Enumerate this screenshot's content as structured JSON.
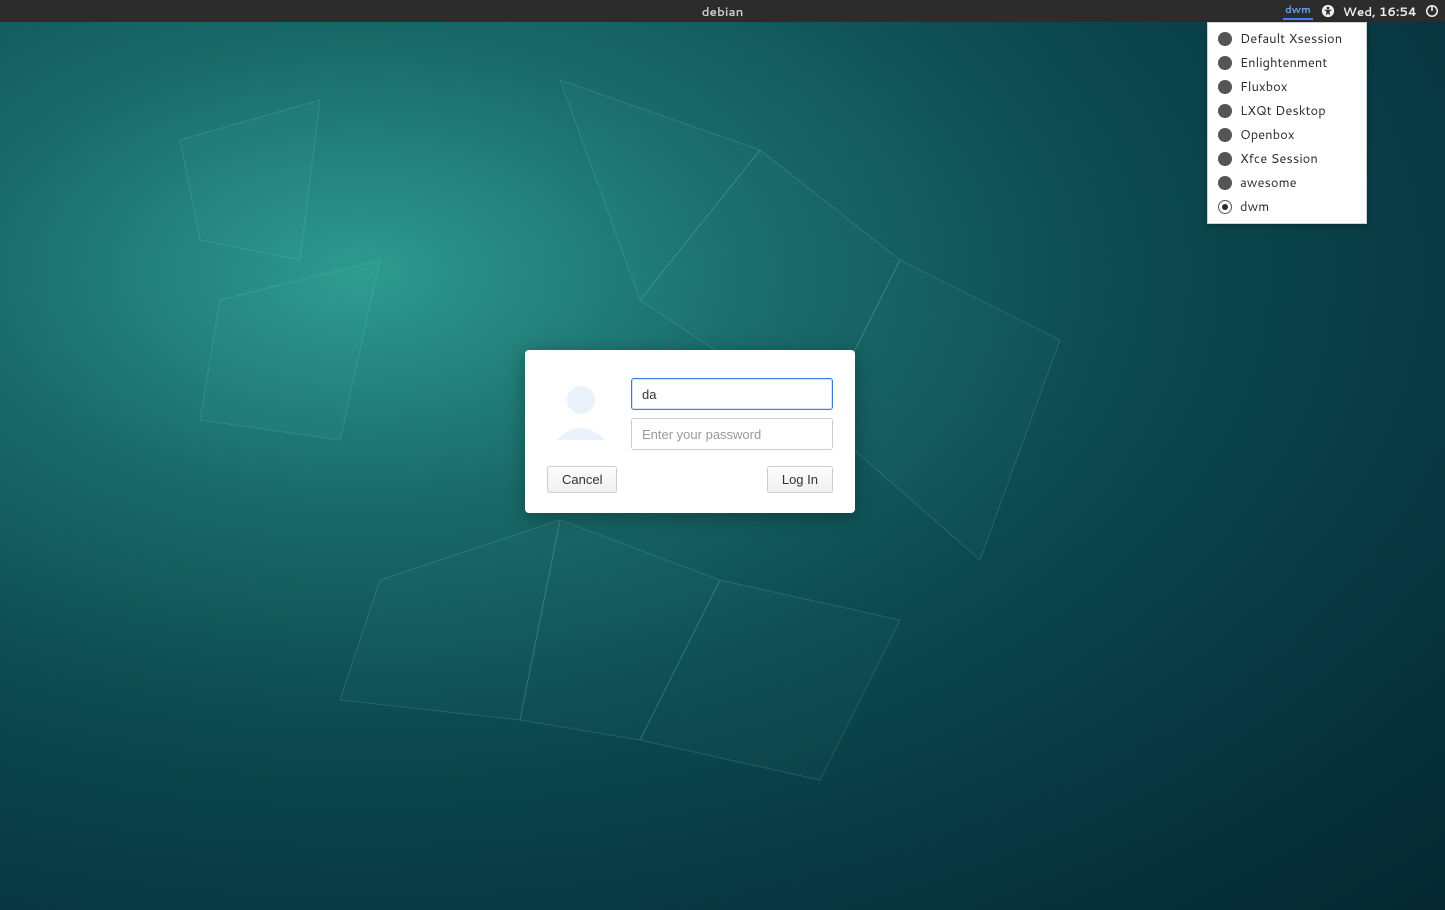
{
  "topbar": {
    "hostname": "debian",
    "session_indicator": "dwm",
    "clock": "Wed, 16:54"
  },
  "session_menu": {
    "items": [
      {
        "label": "Default Xsession",
        "selected": false
      },
      {
        "label": "Enlightenment",
        "selected": false
      },
      {
        "label": "Fluxbox",
        "selected": false
      },
      {
        "label": "LXQt Desktop",
        "selected": false
      },
      {
        "label": "Openbox",
        "selected": false
      },
      {
        "label": "Xfce Session",
        "selected": false
      },
      {
        "label": "awesome",
        "selected": false
      },
      {
        "label": "dwm",
        "selected": true
      }
    ]
  },
  "login": {
    "username_value": "da",
    "password_value": "",
    "password_placeholder": "Enter your password",
    "cancel_label": "Cancel",
    "login_label": "Log In"
  }
}
